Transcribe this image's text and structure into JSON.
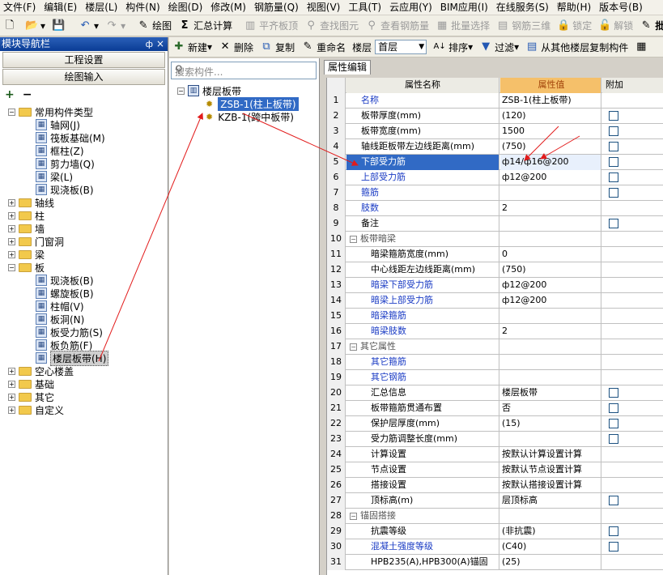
{
  "menubar": [
    "文件(F)",
    "编辑(E)",
    "楼层(L)",
    "构件(N)",
    "绘图(D)",
    "修改(M)",
    "钢筋量(Q)",
    "视图(V)",
    "工具(T)",
    "云应用(Y)",
    "BIM应用(I)",
    "在线服务(S)",
    "帮助(H)",
    "版本号(B)"
  ],
  "toolbar1": {
    "draw": "绘图",
    "sum_calc": "汇总计算",
    "level_top": "平齐板顶",
    "find_elem": "查找图元",
    "view_rebar": "查看钢筋量",
    "batch_select": "批量选择",
    "rebar_3d": "钢筋三维",
    "lock": "锁定",
    "unlock": "解锁",
    "batch": "批量"
  },
  "toolbar2": {
    "new": "新建",
    "delete": "删除",
    "copy": "复制",
    "rename": "重命名",
    "floor_label": "楼层",
    "floor_value": "首层",
    "sort": "排序",
    "filter": "过滤",
    "copy_from_floor": "从其他楼层复制构件"
  },
  "leftnav": {
    "title": "模块导航栏",
    "pin": "ф",
    "close": "×",
    "btn_project": "工程设置",
    "btn_draw": "绘图输入",
    "tools_add": "+",
    "tools_remove": "−",
    "tree": {
      "common": "常用构件类型",
      "common_items": [
        "轴网(J)",
        "筏板基础(M)",
        "框柱(Z)",
        "剪力墙(Q)",
        "梁(L)",
        "现浇板(B)"
      ],
      "axis": "轴线",
      "column": "柱",
      "wall": "墙",
      "door_window": "门窗洞",
      "beam": "梁",
      "slab": "板",
      "slab_items": [
        "现浇板(B)",
        "螺旋板(B)",
        "柱帽(V)",
        "板洞(N)",
        "板受力筋(S)",
        "板负筋(F)",
        "楼层板带(H)"
      ],
      "hollow": "空心楼盖",
      "foundation": "基础",
      "other": "其它",
      "custom": "自定义"
    }
  },
  "midpanel": {
    "search_placeholder": "搜索构件...",
    "root": "楼层板带",
    "items": [
      "ZSB-1(柱上板带)",
      "KZB-1(跨中板带)"
    ]
  },
  "props": {
    "tab": "属性编辑",
    "col_name": "属性名称",
    "col_value": "属性值",
    "col_add": "附加",
    "rows": [
      {
        "n": "1",
        "name": "名称",
        "value": "ZSB-1(柱上板带)",
        "blue": true,
        "chk": false
      },
      {
        "n": "2",
        "name": "板带厚度(mm)",
        "value": "(120)",
        "chk": true
      },
      {
        "n": "3",
        "name": "板带宽度(mm)",
        "value": "1500",
        "chk": true
      },
      {
        "n": "4",
        "name": "轴线距板带左边线距离(mm)",
        "value": "(750)",
        "chk": true
      },
      {
        "n": "5",
        "name": "下部受力筋",
        "value": "ф14/ф16@200",
        "blue": true,
        "chk": true,
        "selected": true
      },
      {
        "n": "6",
        "name": "上部受力筋",
        "value": "ф12@200",
        "blue": true,
        "chk": true
      },
      {
        "n": "7",
        "name": "箍筋",
        "value": "",
        "blue": true,
        "chk": true
      },
      {
        "n": "8",
        "name": "肢数",
        "value": "2",
        "blue": true,
        "chk": false
      },
      {
        "n": "9",
        "name": "备注",
        "value": "",
        "chk": true
      },
      {
        "n": "10",
        "name": "板带暗梁",
        "value": "",
        "group": true
      },
      {
        "n": "11",
        "name": "暗梁箍筋宽度(mm)",
        "value": "0",
        "sub": true
      },
      {
        "n": "12",
        "name": "中心线距左边线距离(mm)",
        "value": "(750)",
        "sub": true
      },
      {
        "n": "13",
        "name": "暗梁下部受力筋",
        "value": "ф12@200",
        "sub": true,
        "blue": true
      },
      {
        "n": "14",
        "name": "暗梁上部受力筋",
        "value": "ф12@200",
        "sub": true,
        "blue": true
      },
      {
        "n": "15",
        "name": "暗梁箍筋",
        "value": "",
        "sub": true,
        "blue": true
      },
      {
        "n": "16",
        "name": "暗梁肢数",
        "value": "2",
        "sub": true,
        "blue": true
      },
      {
        "n": "17",
        "name": "其它属性",
        "value": "",
        "group": true
      },
      {
        "n": "18",
        "name": "其它箍筋",
        "value": "",
        "sub": true,
        "blue": true
      },
      {
        "n": "19",
        "name": "其它钢筋",
        "value": "",
        "sub": true,
        "blue": true
      },
      {
        "n": "20",
        "name": "汇总信息",
        "value": "楼层板带",
        "sub": true,
        "chk": true
      },
      {
        "n": "21",
        "name": "板带箍筋贯通布置",
        "value": "否",
        "sub": true,
        "chk": true
      },
      {
        "n": "22",
        "name": "保护层厚度(mm)",
        "value": "(15)",
        "sub": true,
        "chk": true
      },
      {
        "n": "23",
        "name": "受力筋调整长度(mm)",
        "value": "",
        "sub": true,
        "chk": true
      },
      {
        "n": "24",
        "name": "计算设置",
        "value": "按默认计算设置计算",
        "sub": true
      },
      {
        "n": "25",
        "name": "节点设置",
        "value": "按默认节点设置计算",
        "sub": true
      },
      {
        "n": "26",
        "name": "搭接设置",
        "value": "按默认搭接设置计算",
        "sub": true
      },
      {
        "n": "27",
        "name": "顶标高(m)",
        "value": "层顶标高",
        "sub": true,
        "chk": true
      },
      {
        "n": "28",
        "name": "锚固搭接",
        "value": "",
        "group": true
      },
      {
        "n": "29",
        "name": "抗震等级",
        "value": "(非抗震)",
        "sub": true,
        "chk": true
      },
      {
        "n": "30",
        "name": "混凝土强度等级",
        "value": "(C40)",
        "sub": true,
        "blue": true,
        "chk": true
      },
      {
        "n": "31",
        "name": "HPB235(A),HPB300(A)锚固",
        "value": "(25)",
        "sub": true
      }
    ]
  }
}
